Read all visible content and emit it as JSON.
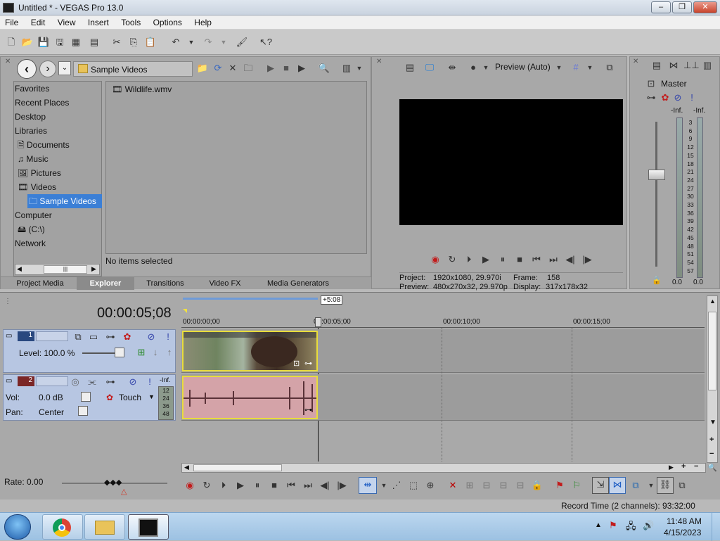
{
  "window": {
    "title": "Untitled * - VEGAS Pro 13.0",
    "controls": [
      "–",
      "❐",
      "✕"
    ]
  },
  "menu": [
    "File",
    "Edit",
    "View",
    "Insert",
    "Tools",
    "Options",
    "Help"
  ],
  "explorer": {
    "path": "Sample Videos",
    "tree": [
      "Favorites",
      "Recent Places",
      "Desktop",
      "Libraries",
      "Documents",
      "Music",
      "Pictures",
      "Videos",
      "Sample Videos",
      "Computer",
      "(C:\\)",
      "Network"
    ],
    "files": [
      "Wildlife.wmv"
    ],
    "status": "No items selected",
    "tabs": [
      "Project Media",
      "Explorer",
      "Transitions",
      "Video FX",
      "Media Generators"
    ]
  },
  "preview": {
    "mode": "Preview (Auto)",
    "project_label": "Project:",
    "project_value": "1920x1080, 29.970i",
    "preview_label": "Preview:",
    "preview_value": "480x270x32, 29.970p",
    "frame_label": "Frame:",
    "frame_value": "158",
    "display_label": "Display:",
    "display_value": "317x178x32"
  },
  "mixer": {
    "title": "Master",
    "inf_left": "-Inf.",
    "inf_right": "-Inf.",
    "scale": [
      "3",
      "6",
      "9",
      "12",
      "15",
      "18",
      "21",
      "24",
      "27",
      "30",
      "33",
      "36",
      "39",
      "42",
      "45",
      "48",
      "51",
      "54",
      "57"
    ],
    "bottom_left": "0.0",
    "bottom_right": "0.0"
  },
  "timeline": {
    "timecode": "00:00:05;08",
    "marker_label": "+5:08",
    "ruler": [
      "00:00:00;00",
      "00:00:05;00",
      "00:00:10;00",
      "00:00:15;00"
    ],
    "video_track": {
      "number": "1",
      "level_label": "Level: 100.0 %"
    },
    "audio_track": {
      "number": "2",
      "vol_label": "Vol:",
      "vol_value": "0.0 dB",
      "pan_label": "Pan:",
      "pan_value": "Center",
      "mode": "Touch",
      "meter_top": "-Inf.",
      "meter_scale": [
        "12",
        "24",
        "36",
        "48"
      ]
    },
    "rate": "Rate: 0.00",
    "record_time": "Record Time (2 channels): 93:32:00"
  },
  "taskbar": {
    "time": "11:48 AM",
    "date": "4/15/2023"
  }
}
